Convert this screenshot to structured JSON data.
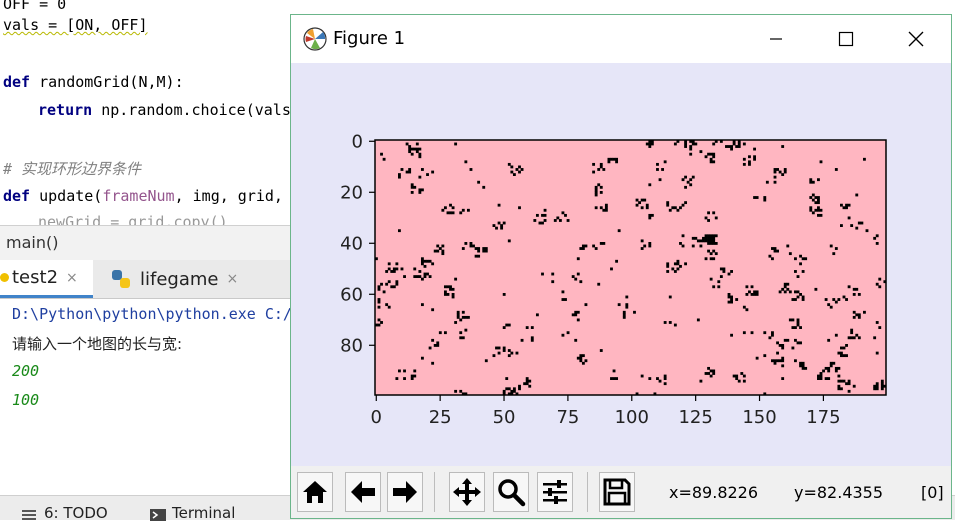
{
  "editor": {
    "line_vals": "vals = [ON, OFF]",
    "line_def_kw": "def",
    "line_def_rest": " randomGrid(N,M):",
    "line_return_kw": "return",
    "line_return_rest": " np.random.choice(vals",
    "comment": "# 实现环形边界条件",
    "update_kw": "def",
    "update_name": " update(",
    "update_param": "frameNum",
    "update_rest": ", img, grid,"
  },
  "breadcrumb": "main()",
  "run_tabs": [
    {
      "label": "test2",
      "close": "×"
    },
    {
      "label": "lifegame",
      "close": "×"
    }
  ],
  "console": {
    "path": "D:\\Python\\python\\python.exe C:/",
    "prompt": "请输入一个地图的长与宽:",
    "input1": "200",
    "input2": "100"
  },
  "bottom_bar": {
    "todo": "6: TODO",
    "terminal": "Terminal"
  },
  "figure": {
    "title": "Figure 1",
    "coord_x": "x=89.8226",
    "coord_y": "y=82.4355",
    "value": "[0]"
  },
  "toolbar_icons": [
    "home-icon",
    "back-arrow-icon",
    "forward-arrow-icon",
    "pan-icon",
    "zoom-icon",
    "configure-subplots-icon",
    "save-icon"
  ],
  "colors": {
    "grid_bg": "#ffb6c1",
    "grid_cell": "#000000",
    "figure_bg": "#e6e6f8"
  },
  "chart_data": {
    "type": "heatmap",
    "grid_cols": 200,
    "grid_rows": 100,
    "x_ticks": [
      "0",
      "25",
      "50",
      "75",
      "100",
      "125",
      "150",
      "175"
    ],
    "y_ticks": [
      "0",
      "20",
      "40",
      "60",
      "80"
    ],
    "xlim": [
      0,
      200
    ],
    "ylim": [
      100,
      0
    ],
    "cmap": [
      "#ffb6c1",
      "#000000"
    ]
  }
}
